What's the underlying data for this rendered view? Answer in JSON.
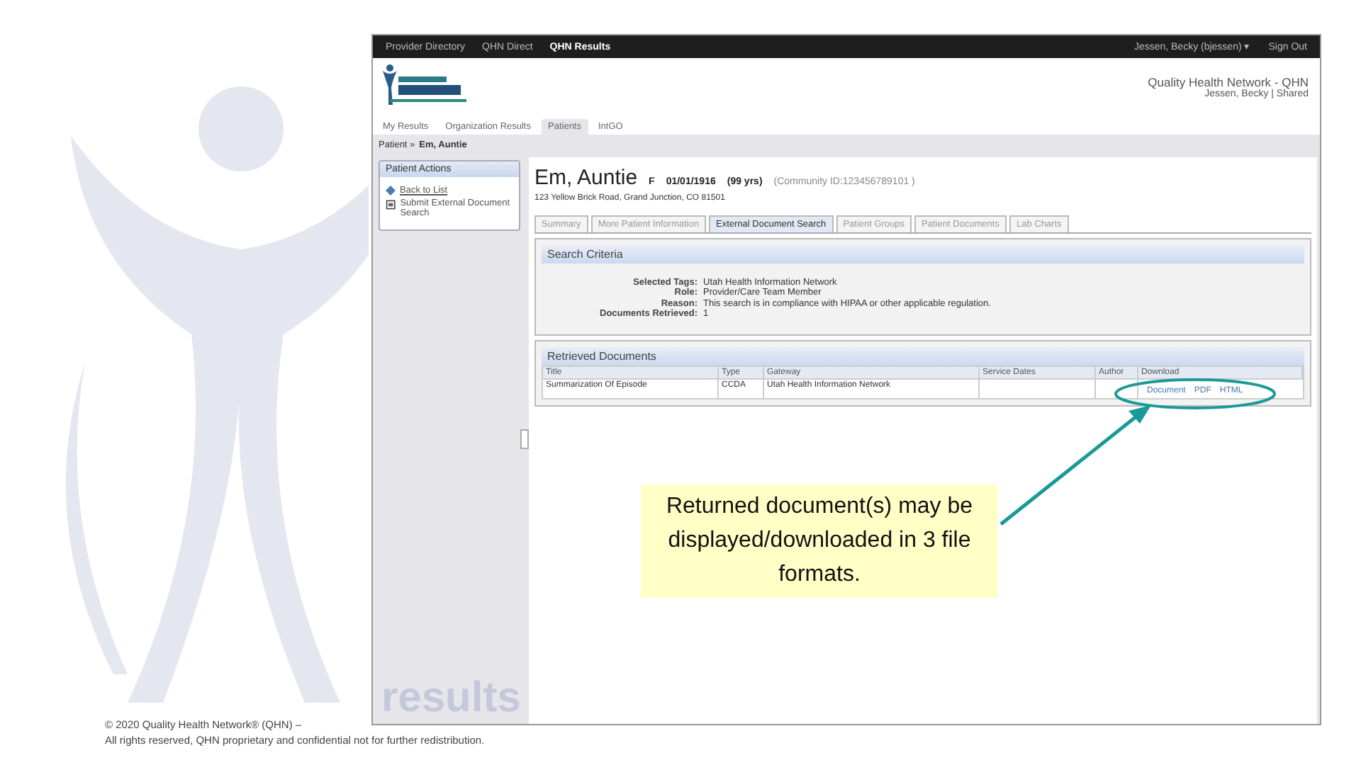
{
  "top_bar": {
    "items": [
      {
        "label": "Provider Directory",
        "selected": false
      },
      {
        "label": "QHN Direct",
        "selected": false
      },
      {
        "label": "QHN Results",
        "selected": true
      }
    ],
    "user": "Jessen, Becky (bjessen) ▾",
    "sign_out": "Sign Out"
  },
  "header": {
    "org": "Quality Health Network - QHN",
    "user_line": "Jessen, Becky | Shared"
  },
  "nav_tabs": [
    {
      "label": "My Results",
      "selected": false
    },
    {
      "label": "Organization Results",
      "selected": false
    },
    {
      "label": "Patients",
      "selected": true
    },
    {
      "label": "IntGO",
      "selected": false
    }
  ],
  "breadcrumb": {
    "prefix": "Patient »",
    "current": "Em, Auntie"
  },
  "sidebar": {
    "title": "Patient Actions",
    "items": [
      {
        "label": "Back to List",
        "kind": "link"
      },
      {
        "label": "Submit External Document Search",
        "kind": "doc"
      }
    ],
    "logo": "results"
  },
  "patient": {
    "name": "Em, Auntie",
    "sex": "F",
    "dob": "01/01/1916",
    "age": "(99 yrs)",
    "community_id": "(Community ID:123456789101 )",
    "address": "123 Yellow Brick Road, Grand Junction, CO 81501"
  },
  "patient_tabs": [
    {
      "label": "Summary",
      "selected": false
    },
    {
      "label": "More Patient Information",
      "selected": false
    },
    {
      "label": "External Document Search",
      "selected": true
    },
    {
      "label": "Patient Groups",
      "selected": false
    },
    {
      "label": "Patient Documents",
      "selected": false
    },
    {
      "label": "Lab Charts",
      "selected": false
    }
  ],
  "search_criteria": {
    "title": "Search Criteria",
    "rows": [
      {
        "label": "Selected Tags:",
        "value": "Utah Health Information Network"
      },
      {
        "label": "Role:",
        "value": "Provider/Care Team Member"
      },
      {
        "label": "Reason:",
        "value": "This search is in compliance with HIPAA or other applicable regulation."
      },
      {
        "label": "Documents Retrieved:",
        "value": "1"
      }
    ]
  },
  "retrieved_documents": {
    "title": "Retrieved Documents",
    "columns": [
      "Title",
      "Type",
      "Gateway",
      "Service Dates",
      "Author",
      "Download"
    ],
    "rows": [
      {
        "title": "Summarization Of Episode",
        "type": "CCDA",
        "gateway": "Utah Health Information Network",
        "links": [
          "Document",
          "PDF",
          "HTML"
        ]
      }
    ]
  },
  "callout": "Returned document(s) may be displayed/downloaded in 3 file formats.",
  "copyright": [
    "© 2020 Quality Health Network® (QHN) –",
    "All rights reserved, QHN proprietary and confidential not for further redistribution."
  ]
}
